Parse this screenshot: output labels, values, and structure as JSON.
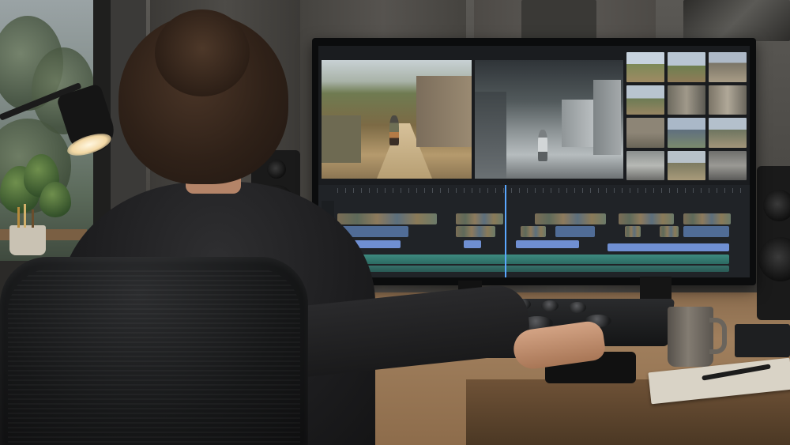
{
  "scene": {
    "description_colors": {
      "wall": "#4a4844",
      "desk": "#a07f5d",
      "timeline_clip": "#506c96",
      "audio_clip": "#3e8a80",
      "playhead": "#5aa7ff",
      "sweater": "#1d1d1f"
    }
  },
  "icons": {
    "lamp": "desk-lamp-icon",
    "plant": "plant-icon",
    "speaker": "speaker-icon",
    "mug": "mug-icon"
  }
}
